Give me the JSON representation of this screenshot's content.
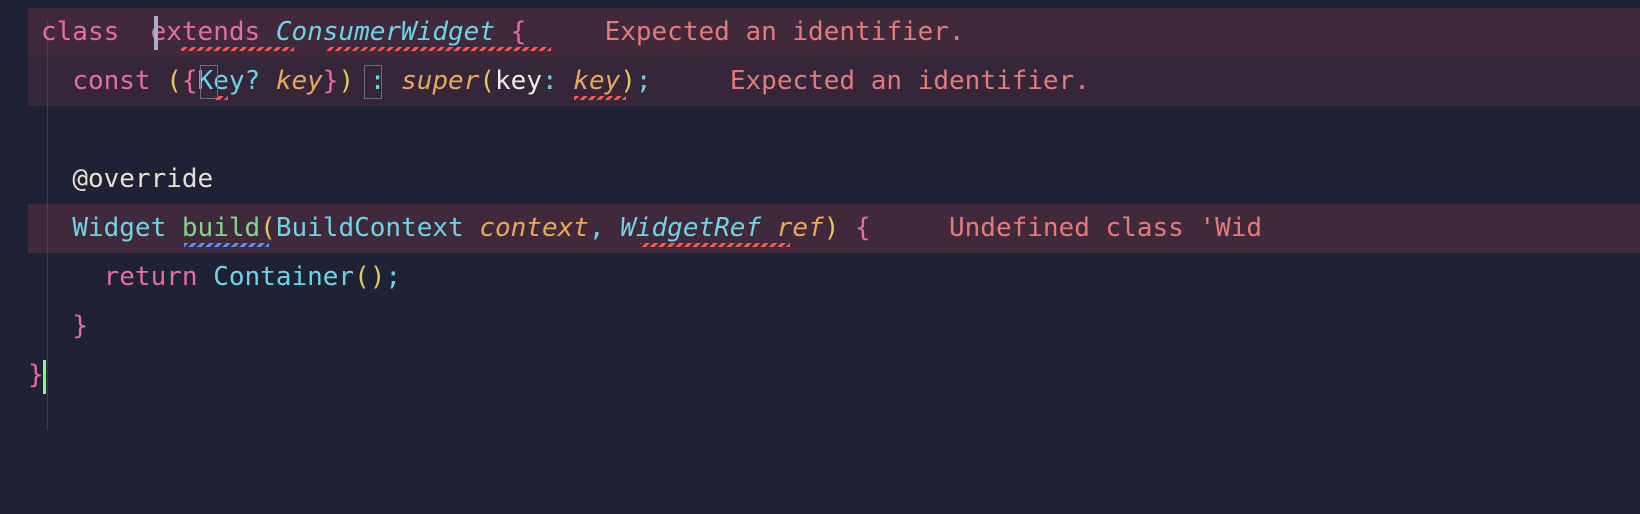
{
  "code": {
    "line1": {
      "class": "class ",
      "extends": " extends ",
      "type": "ConsumerWidget",
      "brace": " {",
      "error": "Expected an identifier."
    },
    "line2": {
      "indent": "  ",
      "const": "const ",
      "lparen": "(",
      "lbrace": "{",
      "keyType": "Key",
      "question": "?",
      "keyParam": " key",
      "rbrace": "}",
      "rparen": ")",
      "colon": " : ",
      "super": "super",
      "lparen2": "(",
      "keyName": "key",
      "colon2": ": ",
      "keyVal": "key",
      "rparen2": ")",
      "semi": ";",
      "error": "Expected an identifier."
    },
    "line4": {
      "indent": "  ",
      "annotation": "@override"
    },
    "line5": {
      "indent": "  ",
      "widget": "Widget",
      "sp1": " ",
      "build": "build",
      "lparen": "(",
      "bc": "BuildContext",
      "sp2": " ",
      "ctx": "context",
      "comma": ", ",
      "wr": "WidgetRef",
      "sp3": " ",
      "ref": "ref",
      "rparen": ")",
      "brace": " {",
      "error": "Undefined class 'Wid"
    },
    "line6": {
      "indent": "    ",
      "return": "return",
      "sp": " ",
      "container": "Container",
      "parens": "()",
      "semi": ";"
    },
    "line7": {
      "indent": "  ",
      "brace": "}"
    },
    "line8": {
      "brace": "}"
    }
  },
  "colors": {
    "bg": "#1f2235",
    "errorBg": "#4a2d38",
    "keyword": "#e86ca0",
    "type": "#6fd3e8",
    "param": "#e8a85c",
    "method": "#7fd88a",
    "error": "#e57a7a",
    "text": "#e0d8c8"
  }
}
